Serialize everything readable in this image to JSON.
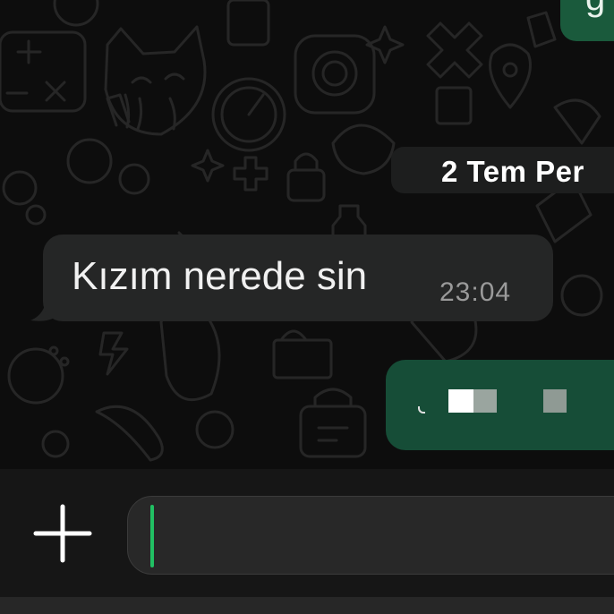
{
  "chat": {
    "top_outgoing_fragment": "g",
    "date_separator": "2 Tem Per",
    "incoming_message": {
      "text": "Kızım nerede sin",
      "time": "23:04"
    },
    "outgoing_message": {
      "redacted": true
    }
  },
  "composer": {
    "attach_icon": "plus-icon",
    "input_value": "",
    "placeholder": ""
  },
  "colors": {
    "chat_background": "#0d0d0d",
    "incoming_bubble": "#252626",
    "outgoing_bubble": "#164d37",
    "caret_accent": "#21c063",
    "composer_bar": "#161616"
  }
}
